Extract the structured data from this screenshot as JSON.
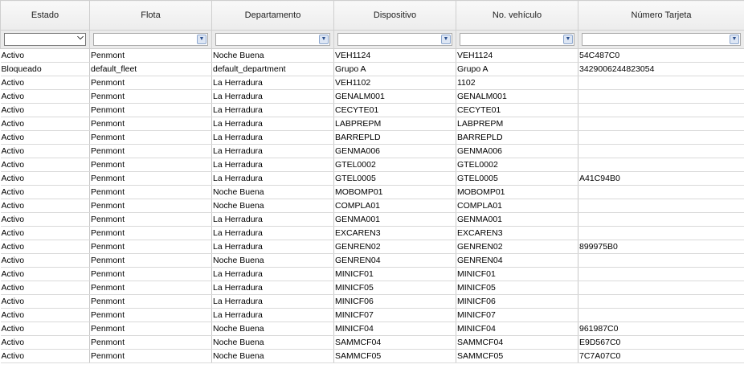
{
  "columns": [
    "Estado",
    "Flota",
    "Departamento",
    "Dispositivo",
    "No. vehículo",
    "Número Tarjeta"
  ],
  "filters": [
    "",
    "",
    "",
    "",
    "",
    ""
  ],
  "rows": [
    [
      "Activo",
      "Penmont",
      "Noche Buena",
      "VEH1124",
      "VEH1124",
      "54C487C0"
    ],
    [
      "Bloqueado",
      "default_fleet",
      "default_department",
      "Grupo A",
      "Grupo A",
      "3429006244823054"
    ],
    [
      "Activo",
      "Penmont",
      "La Herradura",
      "VEH1102",
      "1102",
      ""
    ],
    [
      "Activo",
      "Penmont",
      "La Herradura",
      "GENALM001",
      "GENALM001",
      ""
    ],
    [
      "Activo",
      "Penmont",
      "La Herradura",
      "CECYTE01",
      "CECYTE01",
      ""
    ],
    [
      "Activo",
      "Penmont",
      "La Herradura",
      "LABPREPM",
      "LABPREPM",
      ""
    ],
    [
      "Activo",
      "Penmont",
      "La Herradura",
      "BARREPLD",
      "BARREPLD",
      ""
    ],
    [
      "Activo",
      "Penmont",
      "La Herradura",
      "GENMA006",
      "GENMA006",
      ""
    ],
    [
      "Activo",
      "Penmont",
      "La Herradura",
      "GTEL0002",
      "GTEL0002",
      ""
    ],
    [
      "Activo",
      "Penmont",
      "La Herradura",
      "GTEL0005",
      "GTEL0005",
      "A41C94B0"
    ],
    [
      "Activo",
      "Penmont",
      "Noche Buena",
      "MOBOMP01",
      "MOBOMP01",
      ""
    ],
    [
      "Activo",
      "Penmont",
      "Noche Buena",
      "COMPLA01",
      "COMPLA01",
      ""
    ],
    [
      "Activo",
      "Penmont",
      "La Herradura",
      "GENMA001",
      "GENMA001",
      ""
    ],
    [
      "Activo",
      "Penmont",
      "La Herradura",
      "EXCAREN3",
      "EXCAREN3",
      ""
    ],
    [
      "Activo",
      "Penmont",
      "La Herradura",
      "GENREN02",
      "GENREN02",
      "899975B0"
    ],
    [
      "Activo",
      "Penmont",
      "Noche Buena",
      "GENREN04",
      "GENREN04",
      ""
    ],
    [
      "Activo",
      "Penmont",
      "La Herradura",
      "MINICF01",
      "MINICF01",
      ""
    ],
    [
      "Activo",
      "Penmont",
      "La Herradura",
      "MINICF05",
      "MINICF05",
      ""
    ],
    [
      "Activo",
      "Penmont",
      "La Herradura",
      "MINICF06",
      "MINICF06",
      ""
    ],
    [
      "Activo",
      "Penmont",
      "La Herradura",
      "MINICF07",
      "MINICF07",
      ""
    ],
    [
      "Activo",
      "Penmont",
      "Noche Buena",
      "MINICF04",
      "MINICF04",
      "961987C0"
    ],
    [
      "Activo",
      "Penmont",
      "Noche Buena",
      "SAMMCF04",
      "SAMMCF04",
      "E9D567C0"
    ],
    [
      "Activo",
      "Penmont",
      "Noche Buena",
      "SAMMCF05",
      "SAMMCF05",
      "7C7A07C0"
    ]
  ]
}
